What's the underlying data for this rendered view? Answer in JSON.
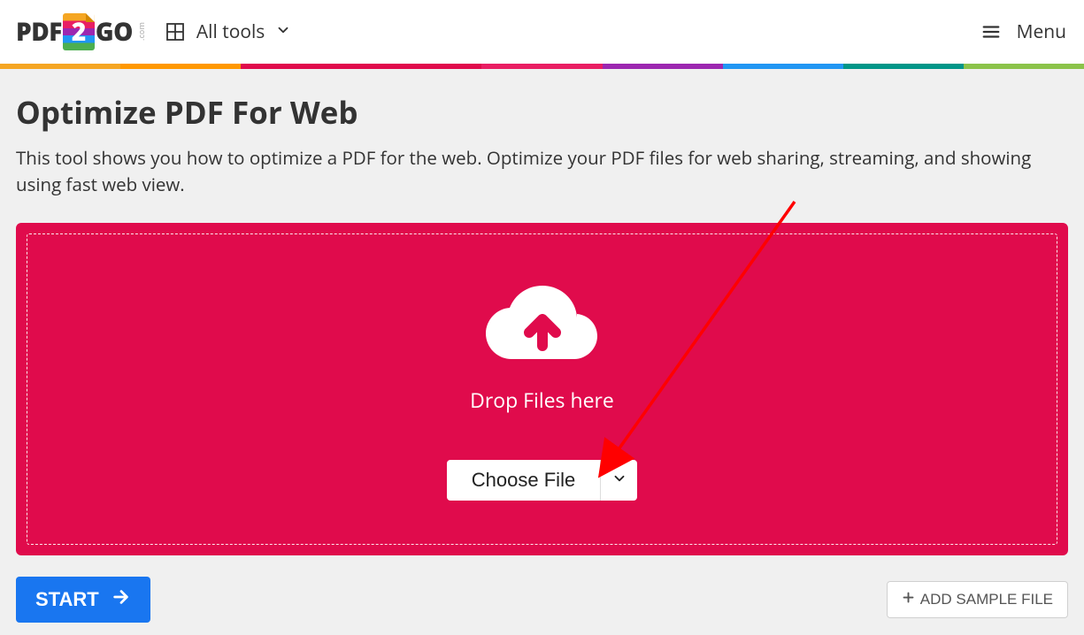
{
  "header": {
    "logo_text_1": "PDF",
    "logo_text_2": "2",
    "logo_text_3": "GO",
    "logo_com": ".com",
    "all_tools_label": "All tools",
    "menu_label": "Menu"
  },
  "stripe_colors": [
    "#f5a623",
    "#ff9800",
    "#e00b4c",
    "#e91e63",
    "#9c27b0",
    "#2196f3",
    "#009688",
    "#8bc34a"
  ],
  "page": {
    "title": "Optimize PDF For Web",
    "subtitle": "This tool shows you how to optimize a PDF for the web. Optimize your PDF files for web sharing, streaming, and showing using fast web view."
  },
  "dropzone": {
    "drop_text": "Drop Files here",
    "choose_label": "Choose File"
  },
  "actions": {
    "start_label": "START",
    "sample_label": "ADD SAMPLE FILE"
  }
}
